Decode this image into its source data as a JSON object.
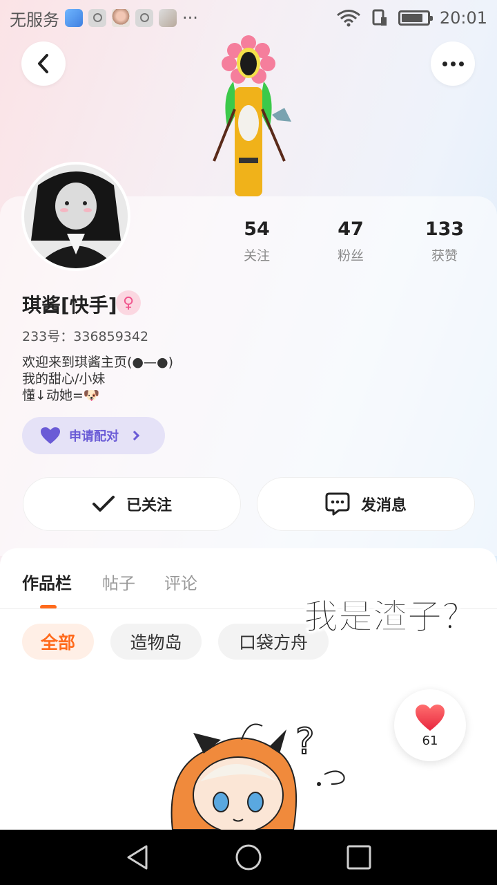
{
  "status_bar": {
    "carrier": "无服务",
    "time": "20:01",
    "more": "···"
  },
  "profile": {
    "name": "琪酱[快手]",
    "gender_symbol": "♀",
    "uid": "233号：336859342",
    "bio": [
      "欢迎来到琪酱主页(●—●)",
      "我的甜心/小妹",
      "懂↓动她=🐶"
    ],
    "stats": [
      {
        "value": "54",
        "label": "关注"
      },
      {
        "value": "47",
        "label": "粉丝"
      },
      {
        "value": "133",
        "label": "获赞"
      }
    ],
    "pair_button": "申请配对"
  },
  "actions": {
    "follow": "已关注",
    "message": "发消息"
  },
  "tabs": [
    {
      "label": "作品栏",
      "active": true
    },
    {
      "label": "帖子",
      "active": false
    },
    {
      "label": "评论",
      "active": false
    }
  ],
  "filters": [
    {
      "label": "全部",
      "active": true
    },
    {
      "label": "造物岛",
      "active": false
    },
    {
      "label": "口袋方舟",
      "active": false
    }
  ],
  "overlay_caption": "我是渣子？",
  "like": {
    "count": "61"
  },
  "colors": {
    "accent": "#ff6a1c",
    "pair_purple": "#6a5bd6",
    "like_red": "#f0465a"
  },
  "icons": {
    "back": "chevron-left-icon",
    "more": "more-dots-icon",
    "follow": "check-icon",
    "message": "chat-bubble-icon",
    "pair": "heart-icon",
    "like": "heart-icon"
  }
}
